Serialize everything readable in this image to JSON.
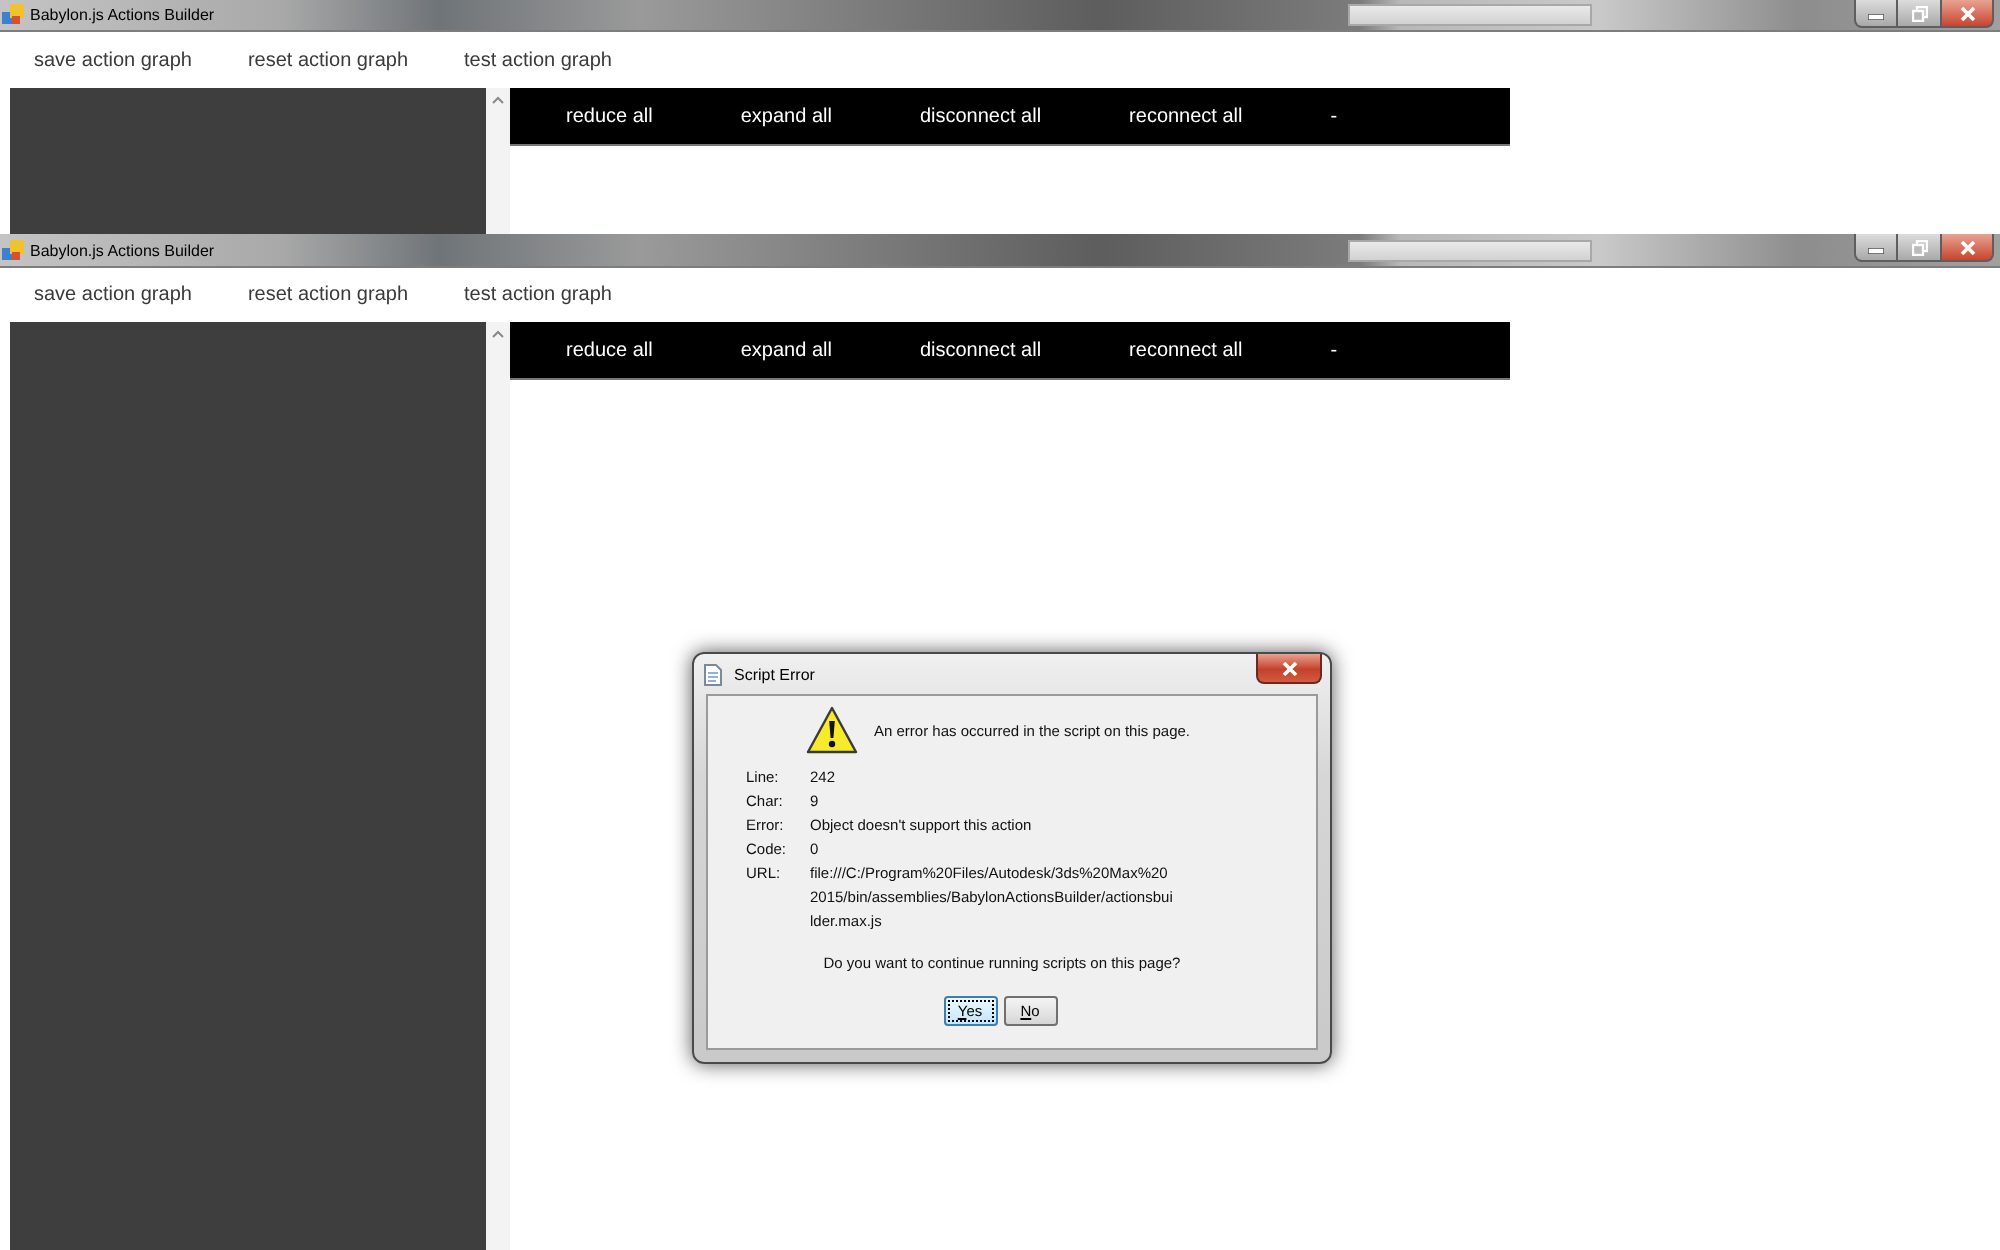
{
  "windows": [
    {
      "title": "Babylon.js Actions Builder",
      "menu": [
        "save action graph",
        "reset action graph",
        "test action graph"
      ],
      "toolbar": [
        "reduce all",
        "expand all",
        "disconnect all",
        "reconnect all",
        "-"
      ]
    },
    {
      "title": "Babylon.js Actions Builder",
      "menu": [
        "save action graph",
        "reset action graph",
        "test action graph"
      ],
      "toolbar": [
        "reduce all",
        "expand all",
        "disconnect all",
        "reconnect all",
        "-"
      ]
    }
  ],
  "dialog": {
    "title": "Script Error",
    "message": "An error has occurred in the script on this page.",
    "details": [
      {
        "label": "Line:",
        "value": "242"
      },
      {
        "label": "Char:",
        "value": "9"
      },
      {
        "label": "Error:",
        "value": "Object doesn't support this action"
      },
      {
        "label": "Code:",
        "value": "0"
      },
      {
        "label": "URL:",
        "value": "file:///C:/Program%20Files/Autodesk/3ds%20Max%202015/bin/assemblies/BabylonActionsBuilder/actionsbuilder.max.js"
      }
    ],
    "question": "Do you want to continue running scripts on this page?",
    "buttons": [
      {
        "label": "Yes",
        "focused": true
      },
      {
        "label": "No",
        "focused": false
      }
    ]
  }
}
